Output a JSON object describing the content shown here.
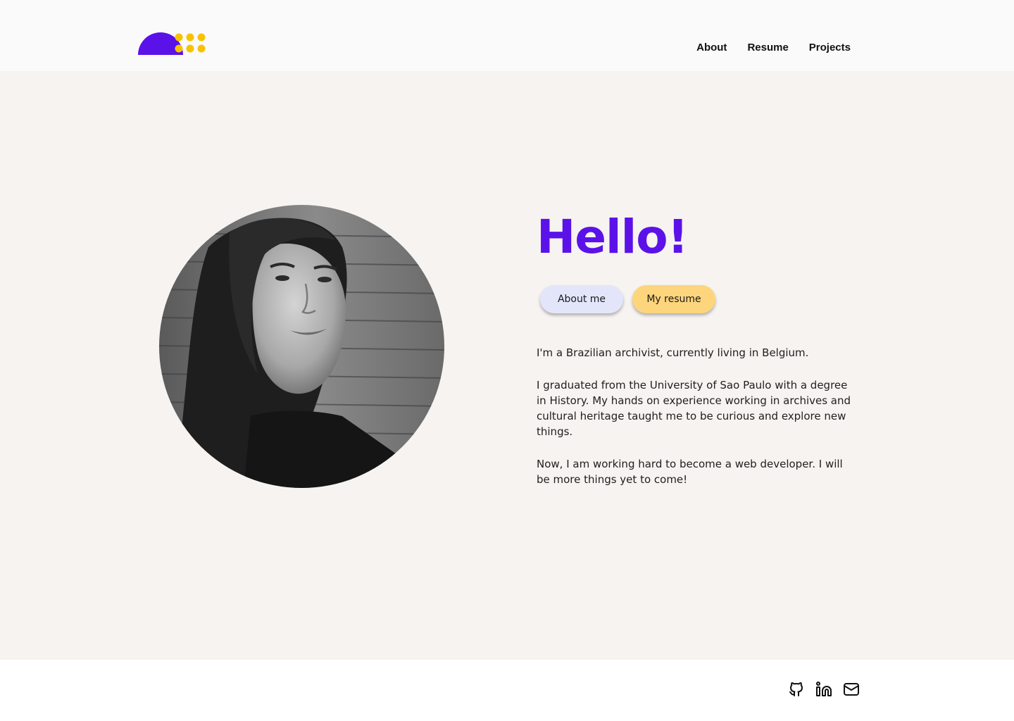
{
  "header": {
    "logo_name": "logo",
    "nav": [
      {
        "label": "About"
      },
      {
        "label": "Resume"
      },
      {
        "label": "Projects"
      }
    ]
  },
  "hero": {
    "title": "Hello!",
    "buttons": {
      "about_label": "About me",
      "resume_label": "My resume"
    },
    "portrait_alt": "portrait photo",
    "bio": [
      "I'm a Brazilian archivist, currently living in Belgium.",
      "I graduated from the University of Sao Paulo with a degree in History. My hands on experience working in archives and cultural heritage taught me to be curious and explore new things.",
      "Now, I am working hard to become a web developer. I will be more things yet to come!"
    ]
  },
  "footer": {
    "social": [
      {
        "icon": "github-icon"
      },
      {
        "icon": "linkedin-icon"
      },
      {
        "icon": "mail-icon"
      }
    ]
  },
  "colors": {
    "accent_purple": "#5b12e9",
    "accent_yellow": "#f7c300",
    "button_about_bg": "#e3e6fb",
    "button_resume_bg": "#fdd57c",
    "header_bg": "#fafafa",
    "main_bg": "#f6f3f0",
    "footer_bg": "#ffffff"
  }
}
